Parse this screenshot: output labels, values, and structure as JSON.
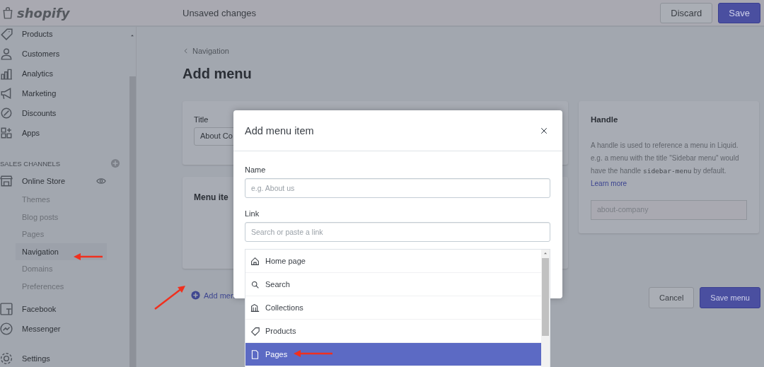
{
  "top_bar": {
    "logo": "shopify",
    "status": "Unsaved changes",
    "buttons": [
      {
        "label": "Discard",
        "kind": "secondary"
      },
      {
        "label": "Save",
        "kind": "primary"
      }
    ]
  },
  "sidebar": {
    "items": [
      {
        "label": "Products"
      },
      {
        "label": "Customers"
      },
      {
        "label": "Analytics"
      },
      {
        "label": "Marketing"
      },
      {
        "label": "Discounts"
      },
      {
        "label": "Apps"
      }
    ],
    "sales_channels": {
      "heading": "SALES CHANNELS",
      "channels": [
        {
          "label": "Online Store",
          "children": [
            {
              "label": "Themes",
              "selected": false
            },
            {
              "label": "Blog posts",
              "selected": false
            },
            {
              "label": "Pages",
              "selected": false
            },
            {
              "label": "Navigation",
              "selected": true
            },
            {
              "label": "Domains",
              "selected": false
            },
            {
              "label": "Preferences",
              "selected": false
            }
          ]
        },
        {
          "label": "Facebook"
        },
        {
          "label": "Messenger"
        }
      ]
    },
    "bottom_items": [
      {
        "label": "Settings"
      }
    ]
  },
  "main": {
    "breadcrumb": "Navigation",
    "title": "Add menu",
    "title_card": {
      "label": "Title",
      "value": "About Co"
    },
    "menu_items_card": {
      "heading": "Menu ite",
      "add_link": "Add men"
    },
    "handle_card": {
      "heading": "Handle",
      "text_before": "A handle is used to reference a menu in Liquid. e.g. a menu with the title \"Sidebar menu\" would have the handle",
      "code": "sidebar-menu",
      "text_after": "by default.",
      "link": "Learn more",
      "value": "about-company"
    },
    "footer_buttons": [
      {
        "label": "Cancel",
        "kind": "secondary"
      },
      {
        "label": "Save menu",
        "kind": "primary"
      }
    ]
  },
  "modal": {
    "title": "Add menu item",
    "fields": [
      {
        "label": "Name",
        "placeholder": "e.g. About us"
      },
      {
        "label": "Link",
        "placeholder": "Search or paste a link"
      }
    ],
    "options": [
      {
        "label": "Home page",
        "selected": false
      },
      {
        "label": "Search",
        "selected": false
      },
      {
        "label": "Collections",
        "selected": false
      },
      {
        "label": "Products",
        "selected": false
      },
      {
        "label": "Pages",
        "selected": true
      }
    ]
  }
}
